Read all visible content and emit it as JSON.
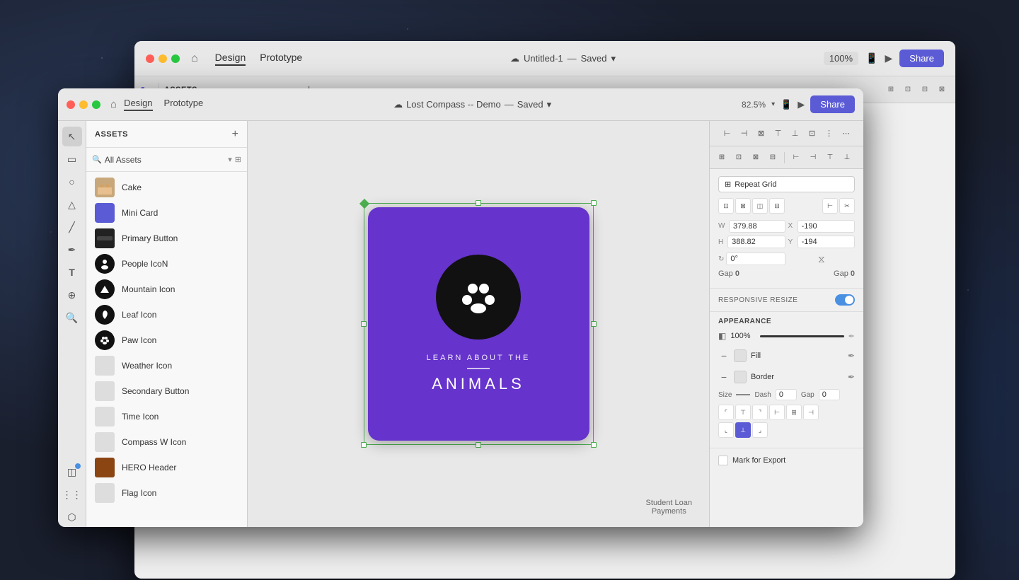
{
  "outerWindow": {
    "title": "Untitled-1",
    "status": "Saved",
    "zoom": "100%",
    "nav": [
      {
        "label": "Design",
        "active": true
      },
      {
        "label": "Prototype",
        "active": false
      }
    ],
    "shareLabel": "Share"
  },
  "innerWindow": {
    "title": "Lost Compass -- Demo",
    "status": "Saved",
    "zoom": "82.5%",
    "nav": [
      {
        "label": "Design",
        "active": true
      },
      {
        "label": "Prototype",
        "active": false
      }
    ],
    "shareLabel": "Share"
  },
  "assets": {
    "panelTitle": "ASSETS",
    "searchPlaceholder": "All Assets",
    "items": [
      {
        "name": "Cake",
        "thumbType": "cake"
      },
      {
        "name": "Mini Card",
        "thumbType": "mini-card"
      },
      {
        "name": "Primary Button",
        "thumbType": "primary-btn"
      },
      {
        "name": "People IcoN",
        "thumbType": "people"
      },
      {
        "name": "Mountain Icon",
        "thumbType": "mountain"
      },
      {
        "name": "Leaf Icon",
        "thumbType": "leaf"
      },
      {
        "name": "Paw Icon",
        "thumbType": "paw"
      },
      {
        "name": "Weather Icon",
        "thumbType": "weather"
      },
      {
        "name": "Secondary Button",
        "thumbType": "secondary"
      },
      {
        "name": "Time Icon",
        "thumbType": "time"
      },
      {
        "name": "Compass W Icon",
        "thumbType": "compass"
      },
      {
        "name": "HERO Header",
        "thumbType": "hero"
      },
      {
        "name": "Flag Icon",
        "thumbType": "flag"
      }
    ]
  },
  "designCard": {
    "subtitle": "LEARN ABOUT THE",
    "title": "ANIMALS"
  },
  "rightPanel": {
    "repeatGridLabel": "Repeat Grid",
    "dimensions": {
      "w": "379.88",
      "x": "-190",
      "h": "388.82",
      "y": "-194",
      "rotation": "0°"
    },
    "responsiveResizeLabel": "RESPONSIVE RESIZE",
    "appearanceLabel": "APPEARANCE",
    "opacity": "100%",
    "fillLabel": "Fill",
    "borderLabel": "Border",
    "borderOptions": {
      "sizeLabel": "Size",
      "dashLabel": "Dash",
      "dashValue": "0",
      "gapLabel": "Gap",
      "gapValue": "0"
    },
    "markForExportLabel": "Mark for Export"
  },
  "studentLoan": {
    "line1": "Student Loan",
    "line2": "Payments"
  }
}
